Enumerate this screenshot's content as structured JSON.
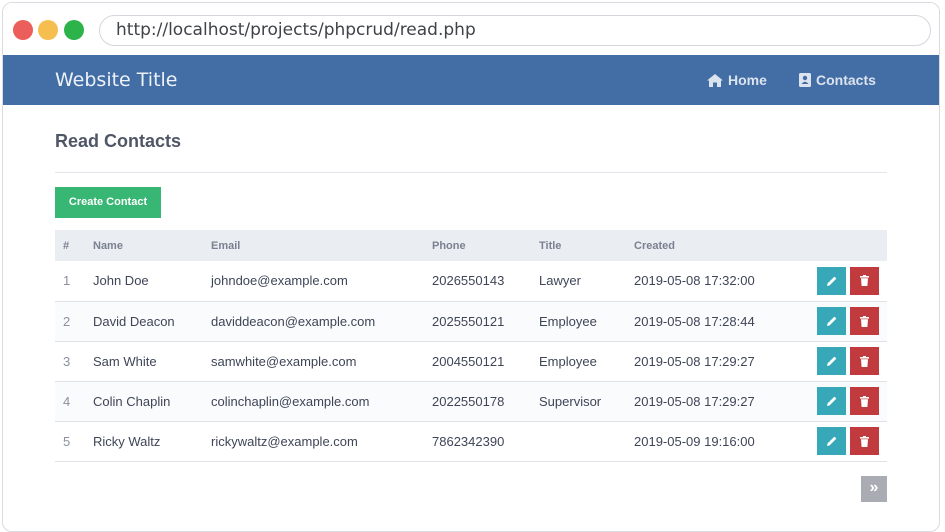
{
  "browser": {
    "url": "http://localhost/projects/phpcrud/read.php"
  },
  "navbar": {
    "title": "Website Title",
    "links": [
      {
        "label": "Home",
        "icon": "home-icon"
      },
      {
        "label": "Contacts",
        "icon": "address-book-icon"
      }
    ]
  },
  "page": {
    "title": "Read Contacts",
    "create_button": "Create Contact"
  },
  "table": {
    "headers": [
      "#",
      "Name",
      "Email",
      "Phone",
      "Title",
      "Created"
    ],
    "rows": [
      [
        "1",
        "John Doe",
        "johndoe@example.com",
        "2026550143",
        "Lawyer",
        "2019-05-08 17:32:00"
      ],
      [
        "2",
        "David Deacon",
        "daviddeacon@example.com",
        "2025550121",
        "Employee",
        "2019-05-08 17:28:44"
      ],
      [
        "3",
        "Sam White",
        "samwhite@example.com",
        "2004550121",
        "Employee",
        "2019-05-08 17:29:27"
      ],
      [
        "4",
        "Colin Chaplin",
        "colinchaplin@example.com",
        "2022550178",
        "Supervisor",
        "2019-05-08 17:29:27"
      ],
      [
        "5",
        "Ricky Waltz",
        "rickywaltz@example.com",
        "7862342390",
        "",
        "2019-05-09 19:16:00"
      ]
    ]
  },
  "pagination": {
    "next_label": "»"
  },
  "colors": {
    "navbar": "#436ea5",
    "create": "#38b673",
    "edit": "#36a8b8",
    "delete": "#c13a3e"
  }
}
